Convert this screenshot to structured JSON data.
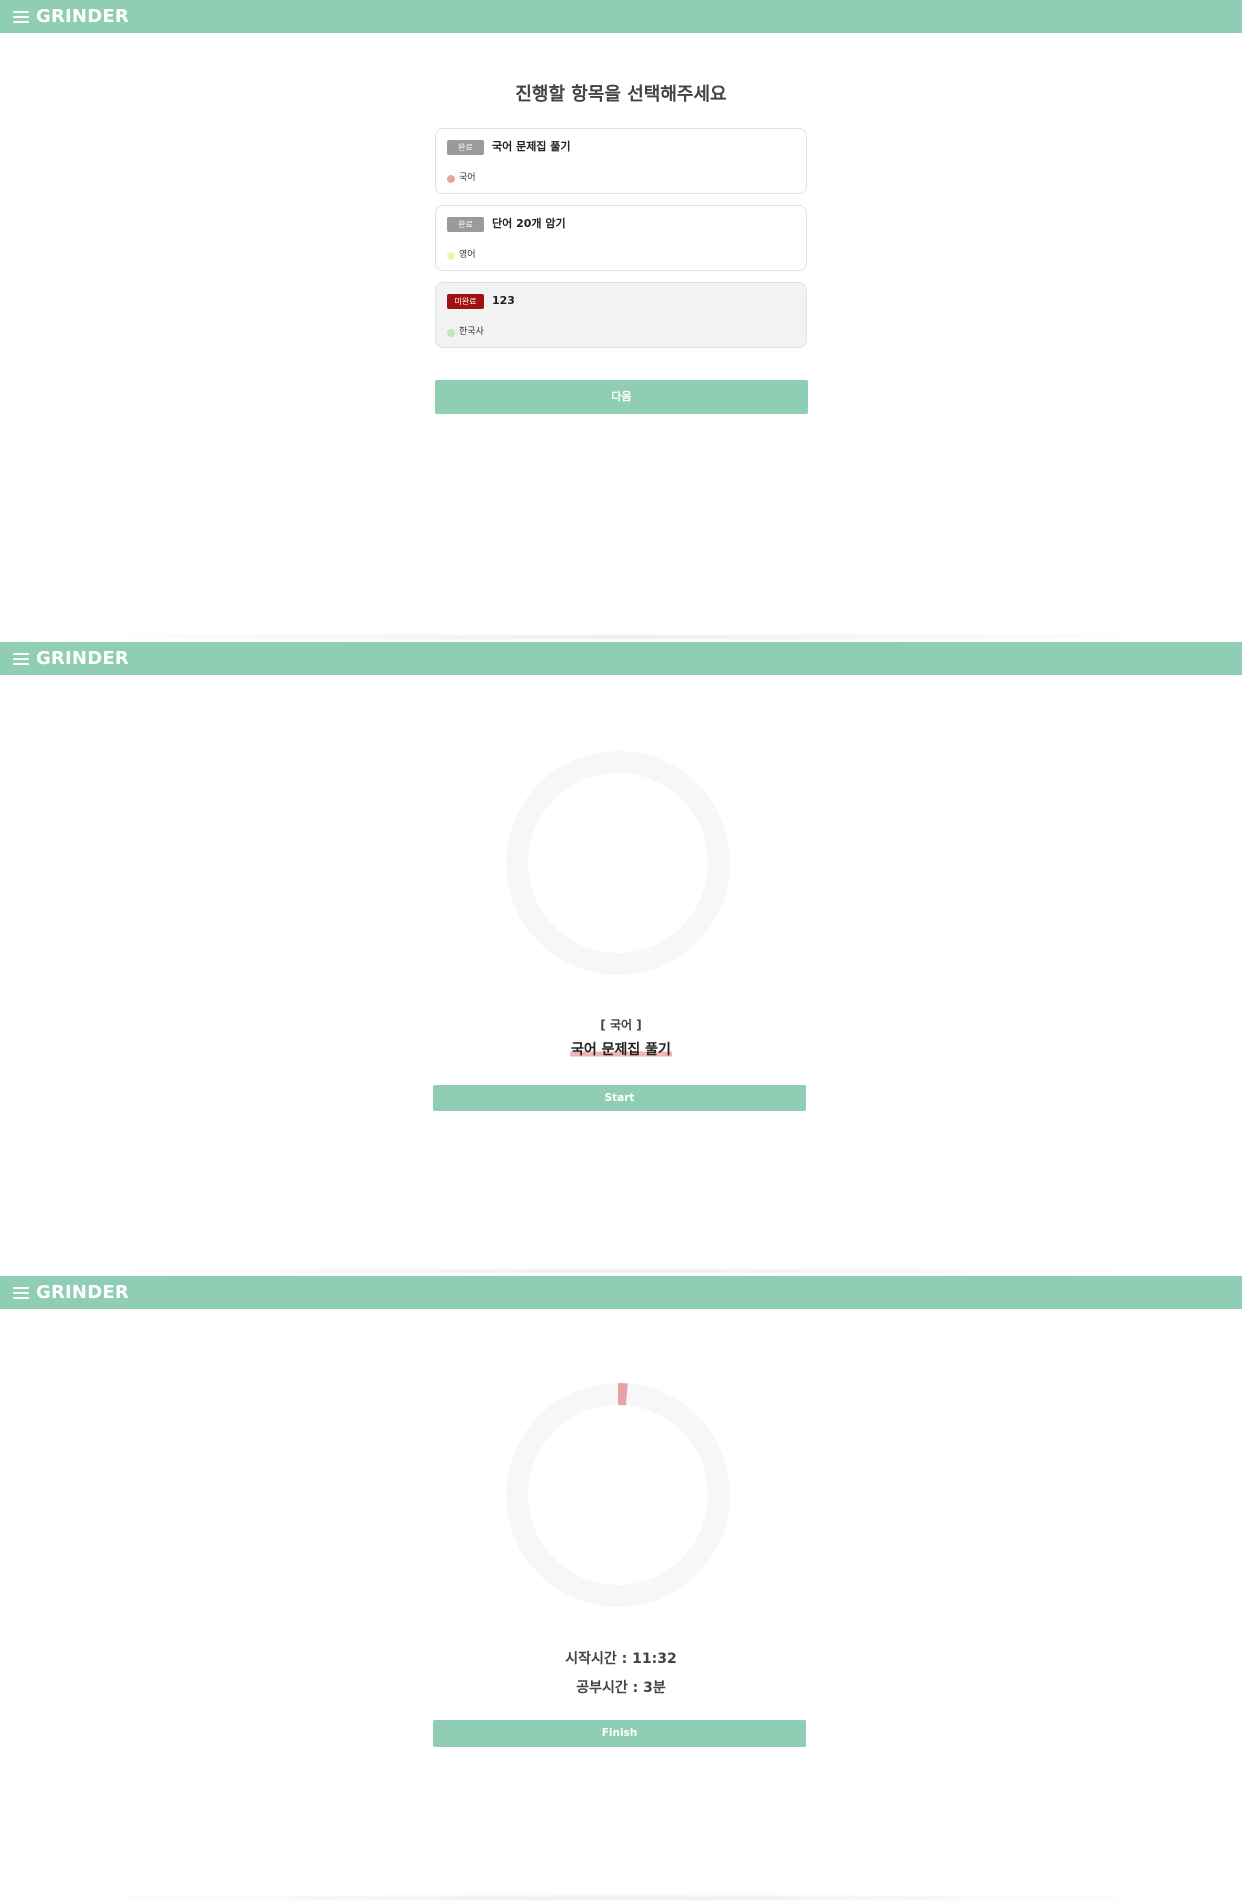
{
  "app": {
    "brand": "GRINDER"
  },
  "select_screen": {
    "heading": "진행할 항목을 선택해주세요",
    "tasks": [
      {
        "status": "완료",
        "title": "국어 문제집 풀기",
        "subject": "국어",
        "subject_color": "#e3a3a7",
        "status_color": "#9a9a9a"
      },
      {
        "status": "완료",
        "title": "단어 20개 암기",
        "subject": "영어",
        "subject_color": "#f4efa7",
        "status_color": "#9a9a9a"
      },
      {
        "status": "미완료",
        "title": "123",
        "subject": "한국사",
        "subject_color": "#bfe6b4",
        "status_color": "#a01212"
      }
    ],
    "next_label": "다음"
  },
  "ready_screen": {
    "subject": "[ 국어 ]",
    "task_title": "국어 문제집 풀기",
    "start_label": "Start",
    "progress_fraction": 0
  },
  "timer_screen": {
    "start_time_text": "시작시간 : 11:32",
    "study_time_text": "공부시간 : 3분",
    "finish_label": "Finish",
    "progress_fraction": 0.014,
    "progress_color": "#e3a3a7"
  },
  "colors": {
    "accent": "#8fcdb5",
    "ring_track": "#f7f7f7"
  }
}
